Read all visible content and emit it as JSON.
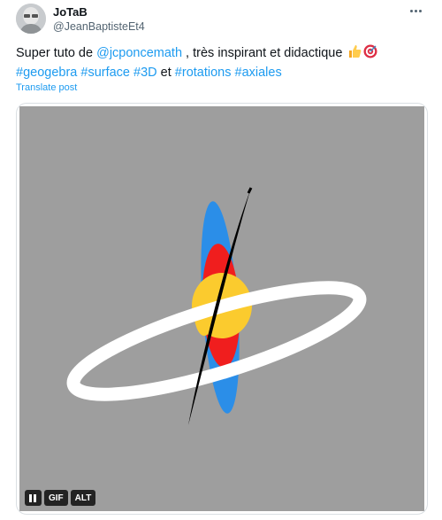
{
  "author": {
    "display_name": "JoTaB",
    "handle": "@JeanBaptisteEt4",
    "avatar_icon": "user-avatar"
  },
  "more_icon": "more-options-icon",
  "post": {
    "text_before": "Super tuto de ",
    "mention": "@jcponcemath",
    "text_after": " , très inspirant et didactique ",
    "emojis": [
      "thumbs-up-icon",
      "direct-hit-icon"
    ],
    "hashtags_line": [
      "#geogebra",
      "#surface",
      "#3D"
    ],
    "connector": "et",
    "hashtags_line_2": [
      "#rotations",
      "#axiales"
    ]
  },
  "translate_label": "Translate post",
  "media": {
    "type": "gif",
    "controls": {
      "pause_icon": "pause-icon",
      "gif_label": "GIF",
      "alt_label": "ALT"
    },
    "colors": {
      "background": "#9e9e9e",
      "ring": "#ffffff",
      "blue": "#2b8ee8",
      "red": "#f01e1e",
      "yellow": "#fbcb2e",
      "axis": "#000000"
    }
  }
}
